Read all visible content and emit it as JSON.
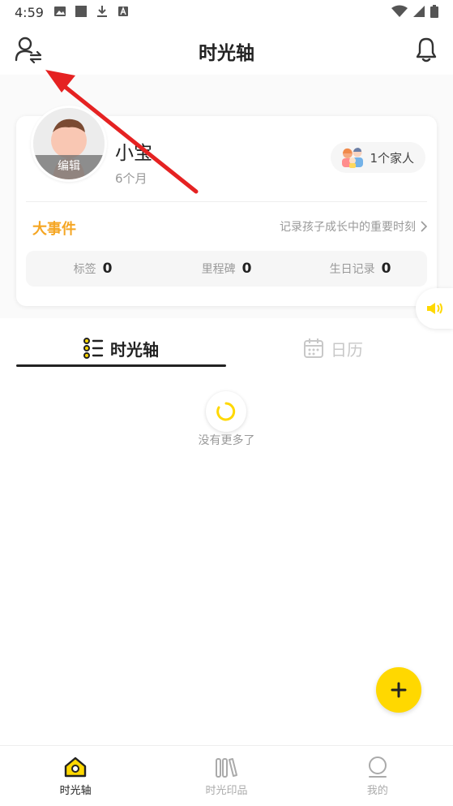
{
  "status_bar": {
    "time": "4:59",
    "left_icons": [
      "image-icon",
      "square-icon",
      "download-icon",
      "font-icon"
    ],
    "right_icons": [
      "wifi-icon",
      "signal-icon",
      "battery-icon"
    ]
  },
  "header": {
    "title": "时光轴"
  },
  "profile": {
    "name": "小宝",
    "age": "6个月",
    "avatar_edit": "编辑",
    "family_count": "1个家人"
  },
  "events": {
    "title": "大事件",
    "hint": "记录孩子成长中的重要时刻"
  },
  "stats": [
    {
      "label": "标签",
      "value": "0"
    },
    {
      "label": "里程碑",
      "value": "0"
    },
    {
      "label": "生日记录",
      "value": "0"
    }
  ],
  "tabs": {
    "timeline": "时光轴",
    "calendar": "日历"
  },
  "feed": {
    "empty_text": "没有更多了"
  },
  "bottom_nav": [
    {
      "label": "时光轴",
      "icon": "home-icon",
      "active": true
    },
    {
      "label": "时光印品",
      "icon": "books-icon",
      "active": false
    },
    {
      "label": "我的",
      "icon": "profile-icon",
      "active": false
    }
  ],
  "colors": {
    "accent": "#ffd800",
    "events_title": "#f5a623",
    "annotation_arrow": "#e52222"
  }
}
